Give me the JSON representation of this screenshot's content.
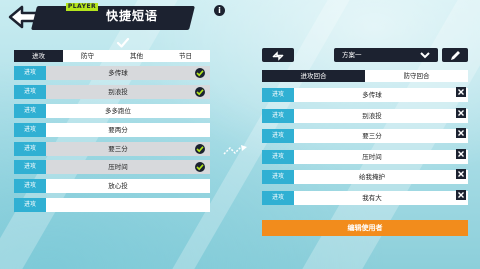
{
  "header": {
    "title": "快捷短语",
    "player_tag": "PLAYER",
    "info_icon": "info-icon",
    "back_icon": "back-arrow-icon"
  },
  "left_tabs": [
    "进攻",
    "防守",
    "其他",
    "节日"
  ],
  "left_active_tab": 0,
  "phrases": [
    {
      "category": "进攻",
      "text": "多传球",
      "selected": true
    },
    {
      "category": "进攻",
      "text": "别浪投",
      "selected": true
    },
    {
      "category": "进攻",
      "text": "多多跑位",
      "selected": false
    },
    {
      "category": "进攻",
      "text": "要两分",
      "selected": false
    },
    {
      "category": "进攻",
      "text": "要三分",
      "selected": true
    },
    {
      "category": "进攻",
      "text": "压时间",
      "selected": true
    },
    {
      "category": "进攻",
      "text": "放心投",
      "selected": false
    },
    {
      "category": "进攻",
      "text": "",
      "selected": false
    }
  ],
  "right": {
    "scheme_label": "方案一",
    "tabs": [
      "进攻回合",
      "防守回合"
    ],
    "active_tab": 0,
    "slots": [
      {
        "category": "进攻",
        "text": "多传球"
      },
      {
        "category": "进攻",
        "text": "别浪投"
      },
      {
        "category": "进攻",
        "text": "要三分"
      },
      {
        "category": "进攻",
        "text": "压时间"
      },
      {
        "category": "进攻",
        "text": "给我掩护"
      },
      {
        "category": "进攻",
        "text": "我有大"
      }
    ],
    "edit_user_label": "编辑使用者"
  },
  "colors": {
    "dark": "#1c2230",
    "category_blue": "#30b0d3",
    "accent_yellow": "#b5e61d",
    "orange": "#f28c1c"
  }
}
